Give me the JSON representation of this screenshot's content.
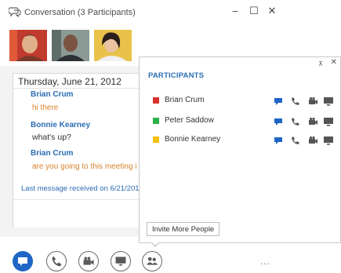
{
  "window": {
    "title": "Conversation (3 Participants)",
    "controls": {
      "minimize": "–",
      "maximize": "☐",
      "close": "✕"
    }
  },
  "avatars": [
    {
      "name": "avatar-brian-crum",
      "color": "#c13a2e"
    },
    {
      "name": "avatar-peter-saddow",
      "color": "#6f7f7a"
    },
    {
      "name": "avatar-bonnie-kearney",
      "color": "#e2b62c"
    }
  ],
  "conversation": {
    "date": "Thursday, June 21, 2012",
    "messages": [
      {
        "sender": "Brian Crum",
        "text": "hi there"
      },
      {
        "sender": "Bonnie Kearney",
        "text": "what's up?"
      },
      {
        "sender": "Brian Crum",
        "text": "are you going to this meeting i"
      }
    ],
    "last_message": "Last message received on 6/21/201"
  },
  "participants": {
    "heading": "PARTICIPANTS",
    "pin": "⊼",
    "close": "✕",
    "people": [
      {
        "name": "Brian Crum",
        "presence_color": "#d9312b"
      },
      {
        "name": "Peter Saddow",
        "presence_color": "#2eb24b"
      },
      {
        "name": "Bonnie Kearney",
        "presence_color": "#f2c10f"
      }
    ],
    "invite_label": "Invite More People"
  },
  "toolbar": {
    "more": "..."
  },
  "colors": {
    "accent": "#2b6db5",
    "orange_text": "#d9822b",
    "im_button": "#1f66c6"
  }
}
